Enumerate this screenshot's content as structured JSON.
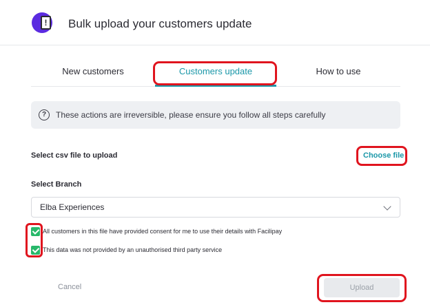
{
  "header": {
    "icon": "document-alert-icon",
    "title": "Bulk upload your customers update"
  },
  "tabs": [
    {
      "label": "New customers",
      "active": false
    },
    {
      "label": "Customers update",
      "active": true
    },
    {
      "label": "How to use",
      "active": false
    }
  ],
  "notice": {
    "icon": "question-circle-icon",
    "text": "These actions are irreversible, please ensure you follow all steps carefully"
  },
  "file": {
    "label": "Select csv file to upload",
    "choose_label": "Choose file"
  },
  "branch": {
    "label": "Select Branch",
    "selected": "Elba Experiences"
  },
  "consents": [
    {
      "label": "All customers in this file have provided consent for me to use their details with Facilipay",
      "checked": true
    },
    {
      "label": "This data was not provided by an unauthorised third party service",
      "checked": true
    }
  ],
  "actions": {
    "cancel_label": "Cancel",
    "upload_label": "Upload"
  },
  "colors": {
    "accent": "#1a97a8",
    "brand_purple": "#5b2be0",
    "check_green": "#28b86a",
    "highlight_red": "#e0141e"
  }
}
